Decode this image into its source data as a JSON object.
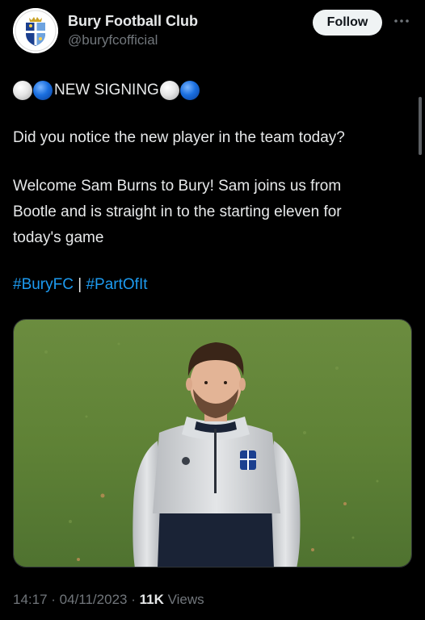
{
  "account": {
    "display_name": "Bury Football Club",
    "handle": "@buryfcofficial",
    "follow_label": "Follow",
    "more_icon": "more-options-icon"
  },
  "tweet": {
    "signing_text": "NEW SIGNING",
    "line_question": "Did you notice the new player in the team today?",
    "welcome_lines": [
      "Welcome Sam Burns to Bury! Sam joins us from",
      "Bootle and is straight in to the starting eleven for",
      "today's game"
    ],
    "hashtags": [
      "#BuryFC",
      "#PartOfIt"
    ],
    "hashtag_separator": " | "
  },
  "meta": {
    "time": "14:17",
    "date": "04/11/2023",
    "separator": " · ",
    "views_count": "11K",
    "views_label": "Views"
  },
  "colors": {
    "background": "#000000",
    "text": "#e7e9ea",
    "muted": "#71767b",
    "link": "#1d9bf0",
    "follow_bg": "#eff3f4",
    "ball_white": "#ffffff",
    "ball_blue": "#1a6fe0"
  }
}
